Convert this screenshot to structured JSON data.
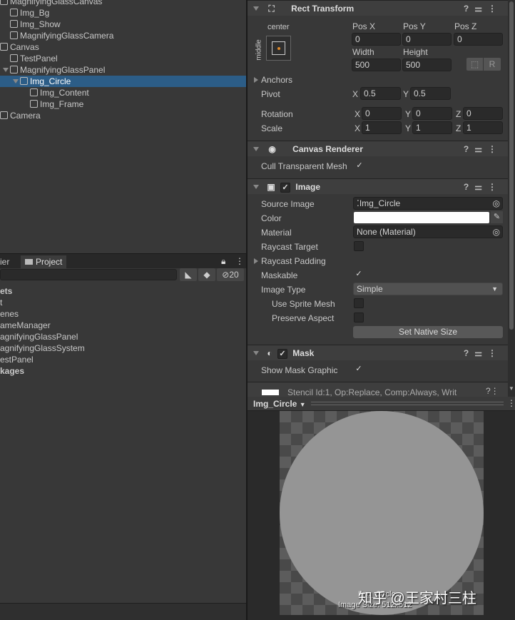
{
  "hierarchy": {
    "items": [
      {
        "label": "MagnifyingGlassCanvas",
        "depth": 0
      },
      {
        "label": "Img_Bg",
        "depth": 1
      },
      {
        "label": "Img_Show",
        "depth": 1
      },
      {
        "label": "MagnifyingGlassCamera",
        "depth": 1
      },
      {
        "label": "Canvas",
        "depth": 0
      },
      {
        "label": "TestPanel",
        "depth": 1
      },
      {
        "label": "MagnifyingGlassPanel",
        "depth": 1
      },
      {
        "label": "Img_Circle",
        "depth": 2
      },
      {
        "label": "Img_Content",
        "depth": 3
      },
      {
        "label": "Img_Frame",
        "depth": 3
      },
      {
        "label": "Camera",
        "depth": 0
      }
    ]
  },
  "project": {
    "tab_other": "ier",
    "tab_project": "Project",
    "hidden_count": "20",
    "items": [
      "ets",
      "t",
      "enes",
      "ameManager",
      "agnifyingGlassPanel",
      "agnifyingGlassSystem",
      "estPanel",
      "kages"
    ]
  },
  "rect": {
    "title": "Rect Transform",
    "anchor_h": "center",
    "anchor_v": "middle",
    "posx_label": "Pos X",
    "posy_label": "Pos Y",
    "posz_label": "Pos Z",
    "posx": "0",
    "posy": "0",
    "posz": "0",
    "width_label": "Width",
    "height_label": "Height",
    "width": "500",
    "height": "500",
    "r_btn": "R",
    "anchors": "Anchors",
    "pivot": "Pivot",
    "pivot_x": "0.5",
    "pivot_y": "0.5",
    "rotation": "Rotation",
    "rot_x": "0",
    "rot_y": "0",
    "rot_z": "0",
    "scale": "Scale",
    "scale_x": "1",
    "scale_y": "1",
    "scale_z": "1",
    "x": "X",
    "y": "Y",
    "z": "Z"
  },
  "canvas_renderer": {
    "title": "Canvas Renderer",
    "cull": "Cull Transparent Mesh"
  },
  "image": {
    "title": "Image",
    "source_label": "Source Image",
    "source": "Img_Circle",
    "color_label": "Color",
    "color": "#ffffff",
    "material_label": "Material",
    "material": "None (Material)",
    "raycast_target": "Raycast Target",
    "raycast_padding": "Raycast Padding",
    "maskable": "Maskable",
    "image_type_label": "Image Type",
    "image_type": "Simple",
    "use_sprite_mesh": "Use Sprite Mesh",
    "preserve_aspect": "Preserve Aspect",
    "native_size": "Set Native Size"
  },
  "mask": {
    "title": "Mask",
    "show_graphic": "Show Mask Graphic"
  },
  "material_row": "Stencil Id:1, Op:Replace, Comp:Always, Writ",
  "preview": {
    "title": "Img_Circle",
    "name": "Img_Circle",
    "size": "Image Size: 512x512"
  },
  "watermark": "知乎 @王家村三柱"
}
